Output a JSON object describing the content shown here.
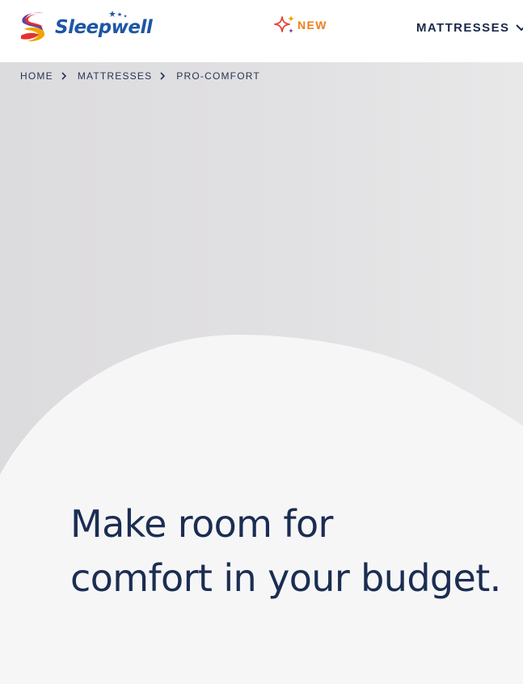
{
  "header": {
    "logo_text": "Sleepwell",
    "new_label": "NEW",
    "nav_mattresses": "MATTRESSES"
  },
  "breadcrumb": [
    {
      "label": "HOME"
    },
    {
      "label": "MATTRESSES"
    },
    {
      "label": "PRO-COMFORT"
    }
  ],
  "hero": {
    "headline_line1": "Make room for",
    "headline_line2": "comfort in your budget."
  },
  "colors": {
    "brand_blue": "#1d56a5",
    "new_orange": "#ef7d1a",
    "text_navy": "#1b2d52",
    "hero_grey": "#dcdbdd"
  },
  "icons": [
    "logo-mark-icon",
    "sparkle-icon",
    "chevron-down-icon",
    "chevron-right-icon"
  ]
}
